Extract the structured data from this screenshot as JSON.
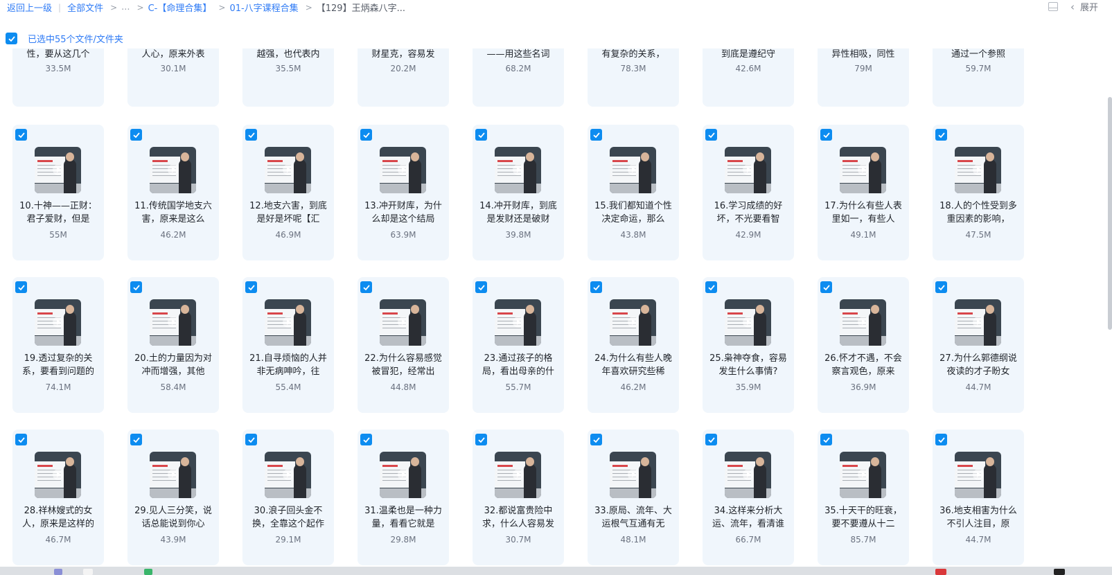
{
  "breadcrumb": {
    "back": "返回上一级",
    "all_files": "全部文件",
    "ellipsis": "...",
    "level1": "C-【命理合集】",
    "level2": "01-八字课程合集",
    "current": "【129】王炳森八字..."
  },
  "top_right": {
    "expand_label": "展开"
  },
  "selection": {
    "text": "已选中55个文件/文件夹"
  },
  "colors": {
    "accent": "#2f7bf5",
    "checkbox": "#0d8cf0",
    "card_bg": "#f0f6fc"
  },
  "partial_row": [
    {
      "name": "性，要从这几个",
      "size": "33.5M"
    },
    {
      "name": "人心，原来外表",
      "size": "30.1M"
    },
    {
      "name": "越强，也代表内",
      "size": "35.5M"
    },
    {
      "name": "财星克，容易发",
      "size": "20.2M"
    },
    {
      "name": "——用这些名词",
      "size": "68.2M"
    },
    {
      "name": "有复杂的关系，",
      "size": "78.3M"
    },
    {
      "name": "到底是遵纪守",
      "size": "42.6M"
    },
    {
      "name": "异性相吸，同性",
      "size": "79M"
    },
    {
      "name": "通过一个参照",
      "size": "59.7M"
    }
  ],
  "rows": [
    [
      {
        "name": "10.十神——正财：\n君子爱财，但是",
        "size": "55M"
      },
      {
        "name": "11.传统国学地支六\n害，原来是这么",
        "size": "46.2M"
      },
      {
        "name": "12.地支六害，到底\n是好是坏呢【汇",
        "size": "46.9M"
      },
      {
        "name": "13.冲开财库，为什\n么却是这个结局",
        "size": "63.9M"
      },
      {
        "name": "14.冲开财库，到底\n是发财还是破财",
        "size": "39.8M"
      },
      {
        "name": "15.我们都知道个性\n决定命运，那么",
        "size": "43.8M"
      },
      {
        "name": "16.学习成绩的好\n坏，不光要看智",
        "size": "42.9M"
      },
      {
        "name": "17.为什么有些人表\n里如一，有些人",
        "size": "49.1M"
      },
      {
        "name": "18.人的个性受到多\n重因素的影响，",
        "size": "47.5M"
      }
    ],
    [
      {
        "name": "19.透过复杂的关\n系，要看到问题的",
        "size": "74.1M"
      },
      {
        "name": "20.土的力量因为对\n冲而增强，其他",
        "size": "58.4M"
      },
      {
        "name": "21.自寻烦恼的人并\n非无病呻吟，往",
        "size": "55.4M"
      },
      {
        "name": "22.为什么容易感觉\n被冒犯，经常出",
        "size": "44.8M"
      },
      {
        "name": "23.通过孩子的格\n局，看出母亲的什",
        "size": "55.7M"
      },
      {
        "name": "24.为什么有些人晚\n年喜欢研究些稀",
        "size": "46.2M"
      },
      {
        "name": "25.枭神夺食，容易\n发生什么事情?",
        "size": "35.9M"
      },
      {
        "name": "26.怀才不遇，不会\n察言观色，原来",
        "size": "36.9M"
      },
      {
        "name": "27.为什么郭德纲说\n夜读的才子盼女",
        "size": "44.7M"
      }
    ],
    [
      {
        "name": "28.祥林嫂式的女\n人，原来是这样的",
        "size": "46.7M"
      },
      {
        "name": "29.见人三分笑，说\n话总能说到你心",
        "size": "43.9M"
      },
      {
        "name": "30.浪子回头金不\n换，全靠这个起作",
        "size": "29.1M"
      },
      {
        "name": "31.温柔也是一种力\n量，看看它就是",
        "size": "29.8M"
      },
      {
        "name": "32.都说富贵险中\n求，什么人容易发",
        "size": "30.7M"
      },
      {
        "name": "33.原局、流年、大\n运根气互通有无",
        "size": "48.1M"
      },
      {
        "name": "34.这样来分析大\n运、流年，看清谁",
        "size": "66.7M"
      },
      {
        "name": "35.十天干的旺衰，\n要不要遵从十二",
        "size": "85.7M"
      },
      {
        "name": "36.地支相害为什么\n不引人注目，原",
        "size": "44.7M"
      }
    ]
  ]
}
